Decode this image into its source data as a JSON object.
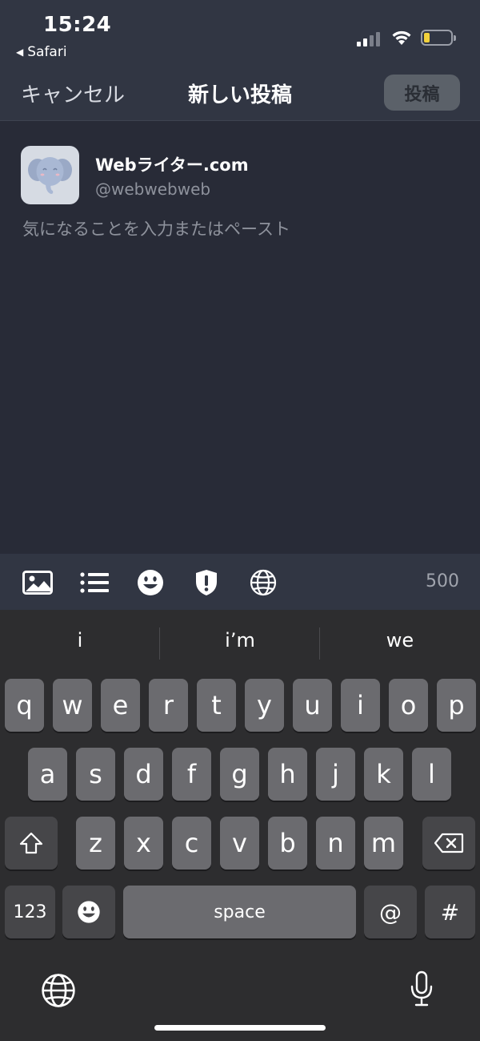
{
  "status_bar": {
    "time": "15:24",
    "back_app": "Safari"
  },
  "nav": {
    "cancel": "キャンセル",
    "title": "新しい投稿",
    "post_button": "投稿"
  },
  "account": {
    "display_name": "Webライター.com",
    "handle": "@webwebweb"
  },
  "compose": {
    "placeholder": "気になることを入力またはペースト",
    "value": ""
  },
  "toolbar": {
    "icons": [
      "image-icon",
      "list-icon",
      "emoji-icon",
      "shield-warning-icon",
      "globe-icon"
    ],
    "char_count": "500"
  },
  "keyboard": {
    "suggestions": [
      "i",
      "i’m",
      "we"
    ],
    "row1": [
      "q",
      "w",
      "e",
      "r",
      "t",
      "y",
      "u",
      "i",
      "o",
      "p"
    ],
    "row2": [
      "a",
      "s",
      "d",
      "f",
      "g",
      "h",
      "j",
      "k",
      "l"
    ],
    "row3": [
      "z",
      "x",
      "c",
      "v",
      "b",
      "n",
      "m"
    ],
    "numbers_key": "123",
    "space_key": "space",
    "at_key": "@",
    "hash_key": "#"
  },
  "colors": {
    "background": "#282b37",
    "bar": "#313643",
    "key": "#6b6b6f",
    "key_dark": "#464649",
    "post_button": "#5b6169"
  }
}
